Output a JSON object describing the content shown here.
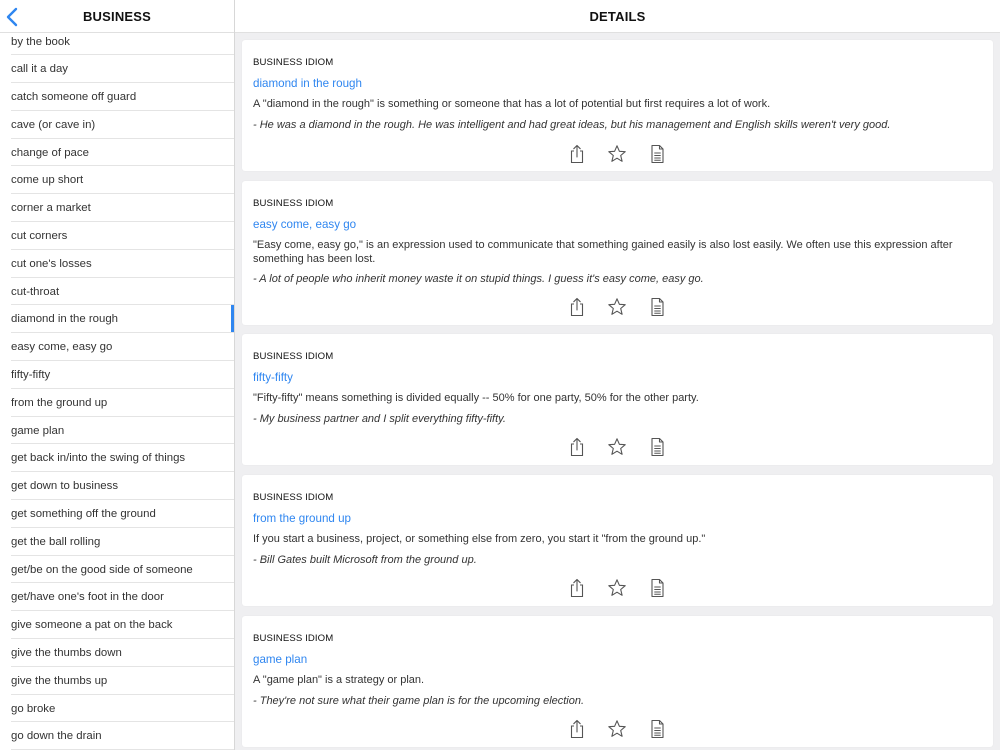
{
  "sidebar": {
    "title": "BUSINESS",
    "back_icon": "chevron-left-icon",
    "items": [
      "by the book",
      "call it a day",
      "catch someone off guard",
      "cave (or cave in)",
      "change of pace",
      "come up short",
      "corner a market",
      "cut corners",
      "cut one's losses",
      "cut-throat",
      "diamond in the rough",
      "easy come, easy go",
      "fifty-fifty",
      "from the ground up",
      "game plan",
      "get back in/into the swing of things",
      "get down to business",
      "get something off the ground",
      "get the ball rolling",
      "get/be on the good side of someone",
      "get/have one's foot in the door",
      "give someone a pat on the back",
      "give the thumbs down",
      "give the thumbs up",
      "go broke",
      "go down the drain"
    ],
    "selected_index": 10
  },
  "details": {
    "title": "DETAILS",
    "cards": [
      {
        "kind": "BUSINESS IDIOM",
        "term": "diamond in the rough",
        "definition": "A \"diamond in the rough\" is something or someone that has a lot of potential but first requires a lot of work.",
        "example": "- He was a diamond in the rough. He was intelligent and had great ideas, but his management and English skills weren't very good."
      },
      {
        "kind": "BUSINESS IDIOM",
        "term": "easy come, easy go",
        "definition": "\"Easy come, easy go,\" is an expression used to communicate that something gained easily is also lost easily. We often use this expression after something has been lost.",
        "example": "- A lot of people who inherit money waste it on stupid things. I guess it's easy come, easy go."
      },
      {
        "kind": "BUSINESS IDIOM",
        "term": "fifty-fifty",
        "definition": "\"Fifty-fifty\" means something is divided equally -- 50% for one party, 50% for the other party.",
        "example": "- My business partner and I split everything fifty-fifty."
      },
      {
        "kind": "BUSINESS IDIOM",
        "term": "from the ground up",
        "definition": "If you start a business, project, or something else from zero, you start it \"from the ground up.\"",
        "example": "- Bill Gates built Microsoft from the ground up."
      },
      {
        "kind": "BUSINESS IDIOM",
        "term": "game plan",
        "definition": "A \"game plan\" is a strategy or plan.",
        "example": "- They're not sure what their game plan is for the upcoming election."
      }
    ],
    "action_icons": [
      "share-icon",
      "star-icon",
      "document-icon"
    ]
  },
  "colors": {
    "accent": "#2f86f0",
    "panel_bg": "#efeff1",
    "card_bg": "#ffffff"
  }
}
